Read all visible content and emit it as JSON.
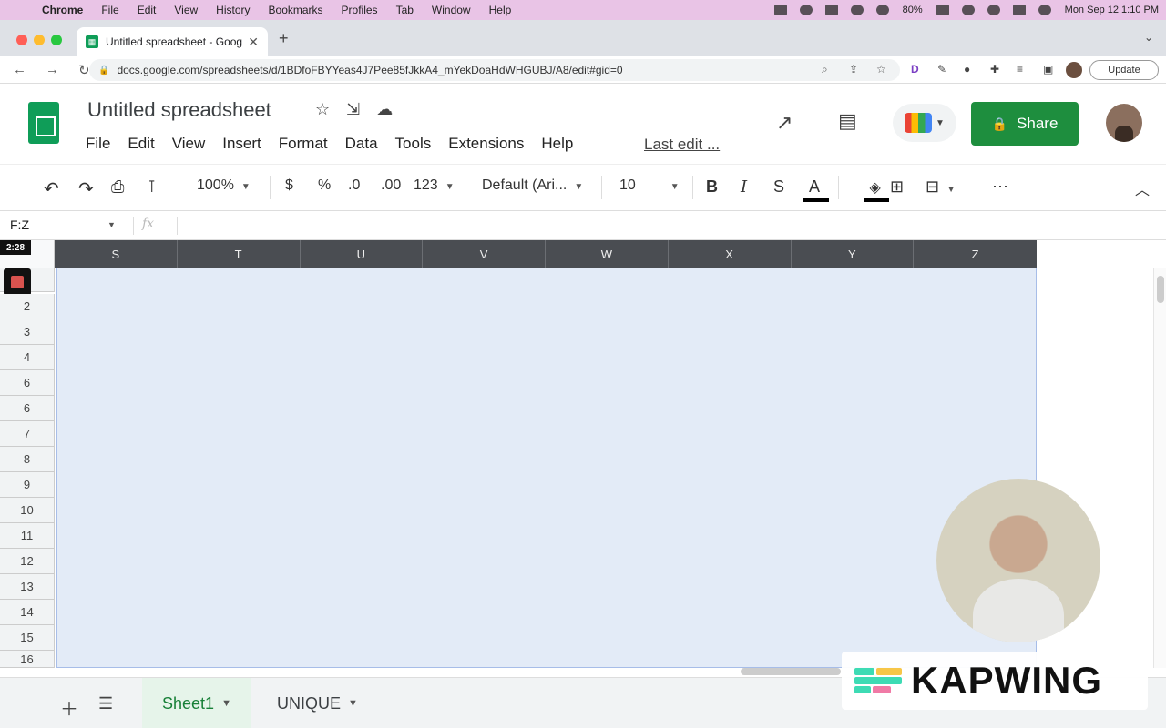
{
  "mac": {
    "menu": [
      "Chrome",
      "File",
      "Edit",
      "View",
      "History",
      "Bookmarks",
      "Profiles",
      "Tab",
      "Window",
      "Help"
    ],
    "battery": "80%",
    "datetime": "Mon Sep 12  1:10 PM"
  },
  "browser": {
    "tab_title": "Untitled spreadsheet - Google",
    "tab_close": "✕",
    "new_tab": "+",
    "url": "docs.google.com/spreadsheets/d/1BDfoFBYYeas4J7Pee85fJkkA4_mYekDoaHdWHGUBJ/A8/edit#gid=0",
    "update_label": "Update"
  },
  "doc": {
    "title": "Untitled spreadsheet",
    "menu": [
      "File",
      "Edit",
      "View",
      "Insert",
      "Format",
      "Data",
      "Tools",
      "Extensions",
      "Help"
    ],
    "last_edit": "Last edit ...",
    "share_label": "Share"
  },
  "toolbar": {
    "zoom": "100%",
    "currency": "$",
    "percent": "%",
    "dec_decrease": ".0",
    "dec_increase": ".00",
    "number_format": "123",
    "font": "Default (Ari...",
    "font_size": "10",
    "bold": "B",
    "italic": "I",
    "strike": "S",
    "text_color": "A",
    "more": "⋯"
  },
  "formula": {
    "name_box": "F:Z",
    "fx": "fx"
  },
  "grid": {
    "columns": [
      "S",
      "T",
      "U",
      "V",
      "W",
      "X",
      "Y",
      "Z"
    ],
    "rows": [
      "2",
      "3",
      "4",
      "6",
      "6",
      "7",
      "8",
      "9",
      "10",
      "11",
      "12",
      "13",
      "14",
      "15",
      "16"
    ],
    "timer": "2:28",
    "header_bg": "#4a4d52",
    "selection_color": "#e3ebf7"
  },
  "sheets": {
    "tabs": [
      "Sheet1",
      "UNIQUE"
    ],
    "active_color": "#188038"
  },
  "overlay": {
    "watermark": "KAPWING"
  },
  "colors": {
    "share": "#1e8e3e",
    "macbar": "#e9c4e6"
  }
}
